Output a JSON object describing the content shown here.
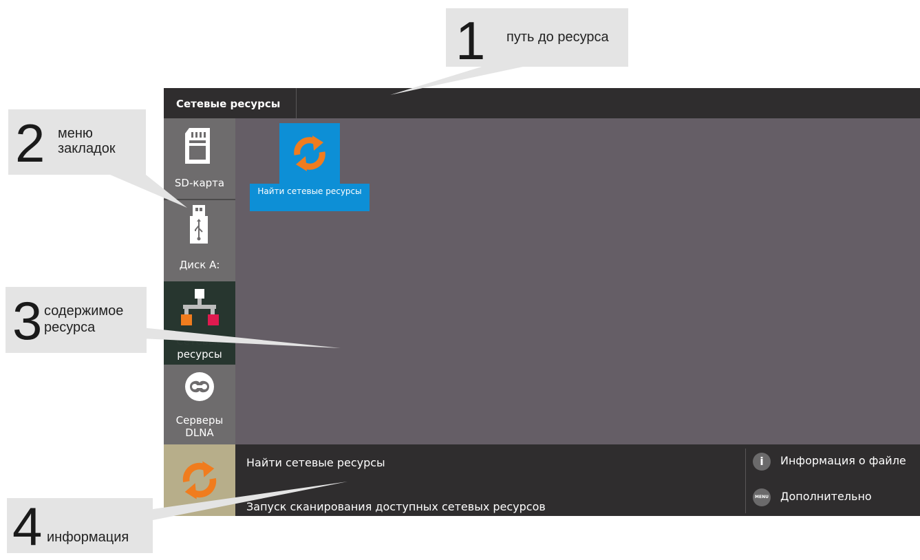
{
  "topbar": {
    "path": "Сетевые ресурсы"
  },
  "sidebar": {
    "items": [
      {
        "label": "SD-карта",
        "icon": "sd-card-icon"
      },
      {
        "label": "Диск А:",
        "icon": "usb-drive-icon"
      },
      {
        "label": "Сетевые ресурсы",
        "label_line2": "ресурсы",
        "icon": "network-icon",
        "active": true
      },
      {
        "label": "Серверы",
        "label_line2": "DLNA",
        "icon": "dlna-server-icon"
      }
    ]
  },
  "content": {
    "tiles": [
      {
        "label": "Найти сетевые ресурсы",
        "icon": "refresh-icon"
      }
    ]
  },
  "infobar": {
    "title": "Найти сетевые ресурсы",
    "description": "Запуск сканирования доступных сетевых ресурсов",
    "actions": [
      {
        "label": "Информация о файле",
        "icon": "info-icon",
        "glyph": "i"
      },
      {
        "label": "Дополнительно",
        "icon": "menu-icon",
        "glyph": "MENU"
      }
    ]
  },
  "callouts": [
    {
      "number": "1",
      "text": "путь до ресурса"
    },
    {
      "number": "2",
      "text_line1": "меню",
      "text_line2": "закладок"
    },
    {
      "number": "3",
      "text_line1": "содержимое",
      "text_line2": "ресурса"
    },
    {
      "number": "4",
      "text": "информация"
    }
  ],
  "colors": {
    "accent_blue": "#0d8fd6",
    "accent_orange": "#f07c1e",
    "bar_dark": "#2f2d2e",
    "content_bg": "#655e66",
    "sidebar_bg": "#6e6c6d",
    "sidebar_active": "#27362f"
  }
}
